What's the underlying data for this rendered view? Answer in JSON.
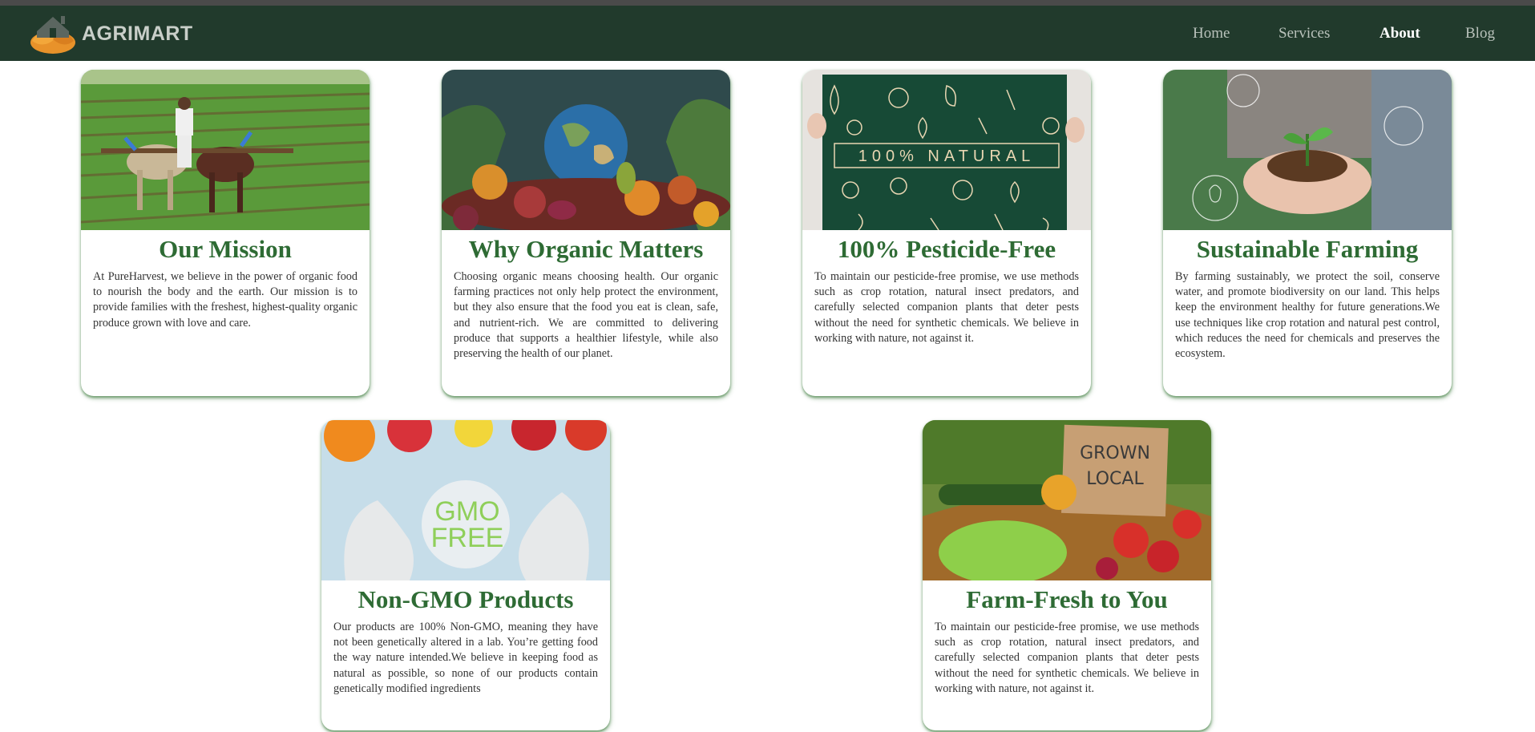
{
  "brand": {
    "name": "AGRIMART",
    "logo_icon": "house-leaf-logo-icon"
  },
  "nav": {
    "items": [
      {
        "label": "Home",
        "active": false
      },
      {
        "label": "Services",
        "active": false
      },
      {
        "label": "About",
        "active": true
      },
      {
        "label": "Blog",
        "active": false
      }
    ]
  },
  "colors": {
    "navbar": "#213a2c",
    "heading": "#2e6b34",
    "accent_orange": "#e8922a"
  },
  "cards": [
    {
      "title": "Our Mission",
      "image": "farmer-plowing-with-oxen-image",
      "text": "At PureHarvest, we believe in the power of organic food to nourish the body and the earth. Our mission is to provide families with the freshest, highest-quality organic produce grown with love and care."
    },
    {
      "title": "Why Organic Matters",
      "image": "globe-among-fruits-image",
      "text": "Choosing organic means choosing health. Our organic farming practices not only help protect the environment, but they also ensure that the food you eat is clean, safe, and nutrient-rich. We are committed to delivering produce that supports a healthier lifestyle, while also preserving the health of our planet."
    },
    {
      "title": "100% Pesticide-Free",
      "image": "natural-vegetables-sign-image",
      "image_text": "100% NATURAL",
      "text": "To maintain our pesticide-free promise, we use methods such as crop rotation, natural insect predators, and carefully selected companion plants that deter pests without the need for synthetic chemicals. We believe in working with nature, not against it."
    },
    {
      "title": "Sustainable Farming",
      "image": "hands-holding-seedling-image",
      "text": "By farming sustainably, we protect the soil, conserve water, and promote biodiversity on our land. This helps keep the environment healthy for future generations.We use techniques like crop rotation and natural pest control, which reduces the need for chemicals and preserves the ecosystem."
    },
    {
      "title": "Non-GMO Products",
      "image": "gmo-free-gloves-image",
      "image_text_1": "GMO",
      "image_text_2": "FREE",
      "text": "Our products are 100% Non-GMO, meaning they have not been genetically altered in a lab. You’re getting food the way nature intended.We believe in keeping food as natural as possible, so none of our products contain genetically modified ingredients"
    },
    {
      "title": "Farm-Fresh to You",
      "image": "grown-local-basket-image",
      "image_text_1": "GROWN",
      "image_text_2": "LOCAL",
      "text": "To maintain our pesticide-free promise, we use methods such as crop rotation, natural insect predators, and carefully selected companion plants that deter pests without the need for synthetic chemicals. We believe in working with nature, not against it."
    }
  ]
}
